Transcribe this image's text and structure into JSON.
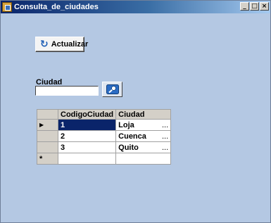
{
  "window": {
    "title": "Consulta_de_ciudades",
    "controls": {
      "minimize": "_",
      "maximize": "□",
      "close": "×"
    }
  },
  "toolbar": {
    "refresh_label": "Actualizar",
    "refresh_icon": "refresh-icon"
  },
  "search": {
    "label": "Ciudad",
    "value": "",
    "button_icon": "search-icon"
  },
  "grid": {
    "columns": [
      "CodigoCiudad",
      "Ciudad"
    ],
    "rows": [
      {
        "code": "1",
        "city": "Loja",
        "current": true
      },
      {
        "code": "2",
        "city": "Cuenca",
        "current": false
      },
      {
        "code": "3",
        "city": "Quito",
        "current": false
      }
    ],
    "ellipsis": "...",
    "current_row_marker": "▶",
    "new_row_marker": "*"
  }
}
